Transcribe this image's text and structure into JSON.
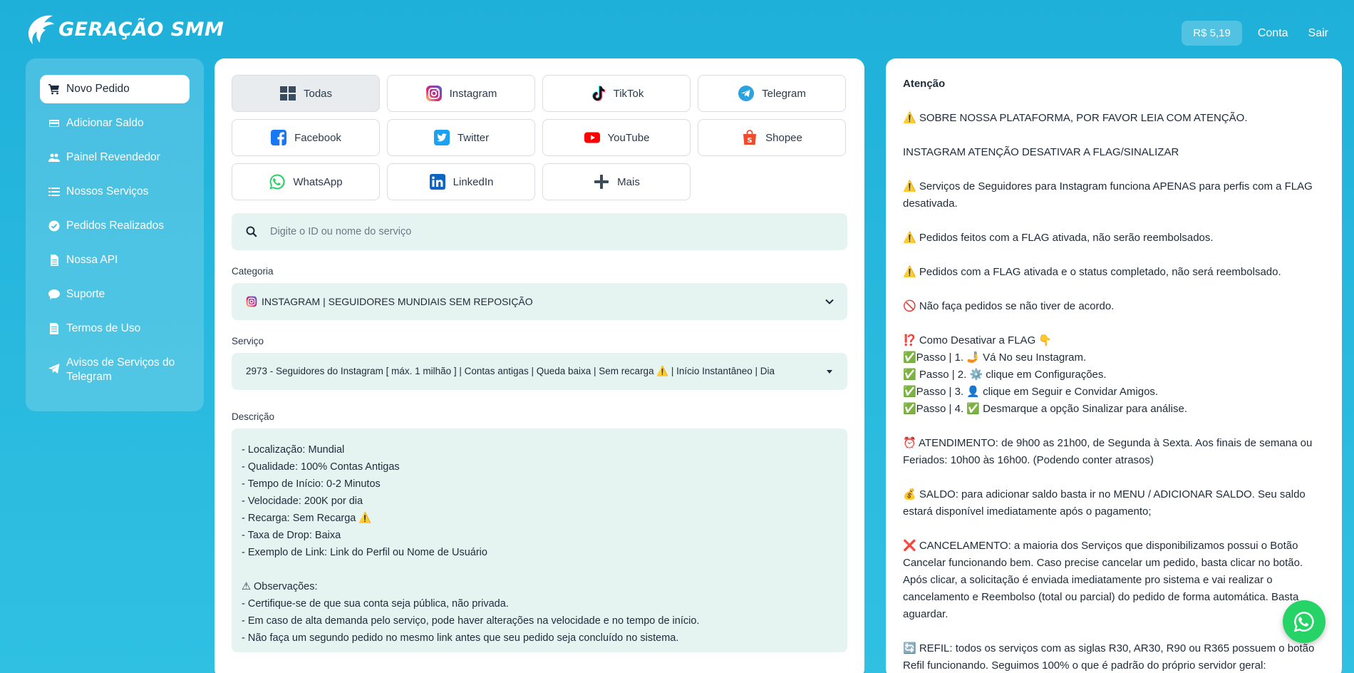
{
  "header": {
    "logo_text": "GERAÇÃO SMM",
    "balance": "R$ 5,19",
    "account_label": "Conta",
    "logout_label": "Sair"
  },
  "sidebar": {
    "items": [
      {
        "label": "Novo Pedido",
        "icon": "cart-icon"
      },
      {
        "label": "Adicionar Saldo",
        "icon": "credit-card-icon"
      },
      {
        "label": "Painel Revendedor",
        "icon": "users-icon"
      },
      {
        "label": "Nossos Serviços",
        "icon": "list-icon"
      },
      {
        "label": "Pedidos Realizados",
        "icon": "check-circle-icon"
      },
      {
        "label": "Nossa API",
        "icon": "file-icon"
      },
      {
        "label": "Suporte",
        "icon": "chat-icon"
      },
      {
        "label": "Termos de Uso",
        "icon": "document-icon"
      },
      {
        "label": "Avisos de Serviços do Telegram",
        "icon": "telegram-icon"
      }
    ]
  },
  "platform_tabs": [
    {
      "label": "Todas",
      "icon": "grid-icon"
    },
    {
      "label": "Instagram",
      "icon": "instagram-icon"
    },
    {
      "label": "TikTok",
      "icon": "tiktok-icon"
    },
    {
      "label": "Telegram",
      "icon": "telegram-icon"
    },
    {
      "label": "Facebook",
      "icon": "facebook-icon"
    },
    {
      "label": "Twitter",
      "icon": "twitter-icon"
    },
    {
      "label": "YouTube",
      "icon": "youtube-icon"
    },
    {
      "label": "Shopee",
      "icon": "shopee-icon"
    },
    {
      "label": "WhatsApp",
      "icon": "whatsapp-icon"
    },
    {
      "label": "LinkedIn",
      "icon": "linkedin-icon"
    },
    {
      "label": "Mais",
      "icon": "plus-icon"
    }
  ],
  "search": {
    "placeholder": "Digite o ID ou nome do serviço"
  },
  "category": {
    "label": "Categoria",
    "value": "INSTAGRAM | SEGUIDORES MUNDIAIS SEM REPOSIÇÃO"
  },
  "service": {
    "label": "Serviço",
    "value": "2973 - Seguidores do Instagram [ máx. 1 milhão ] | Contas antigas | Queda baixa | Sem recarga ⚠️ | Início Instantâneo | Dia"
  },
  "description": {
    "label": "Descrição",
    "lines": [
      "- Localização: Mundial",
      "- Qualidade: 100% Contas Antigas",
      "- Tempo de Início: 0-2 Minutos",
      "- Velocidade: 200K por dia",
      "- Recarga: Sem Recarga ⚠️",
      "- Taxa de Drop: Baixa",
      "- Exemplo de Link: Link do Perfil ou Nome de Usuário",
      "",
      "⚠ Observações:",
      "- Certifique-se de que sua conta seja pública, não privada.",
      "- Em caso de alta demanda pelo serviço, pode haver alterações na velocidade e no tempo de início.",
      "- Não faça um segundo pedido no mesmo link antes que seu pedido seja concluído no sistema."
    ]
  },
  "notice": {
    "title": "Atenção",
    "p1": "⚠️ SOBRE NOSSA PLATAFORMA, POR FAVOR LEIA COM ATENÇÃO.",
    "p2": "INSTAGRAM ATENÇÃO DESATIVAR A FLAG/SINALIZAR",
    "p3": "⚠️ Serviços de Seguidores para Instagram funciona APENAS para perfis com a FLAG desativada.",
    "p4": "⚠️ Pedidos feitos com a FLAG ativada, não serão reembolsados.",
    "p5": "⚠️ Pedidos com a FLAG ativada e o status completado, não será reembolsado.",
    "p6": "🚫 Não faça pedidos se não tiver de acordo.",
    "steps": [
      "⁉️ Como Desativar a FLAG 👇",
      "✅Passo | 1. 🤳 Vá No seu Instagram.",
      "✅ Passo | 2. ⚙️ clique em Configurações.",
      "✅Passo | 3. 👤 clique em Seguir e Convidar Amigos.",
      "✅Passo | 4. ✅ Desmarque a opção Sinalizar para análise."
    ],
    "p7": "⏰ ATENDIMENTO: de 9h00 as 21h00, de Segunda à Sexta. Aos finais de semana ou Feriados: 10h00 às 16h00. (Podendo conter atrasos)",
    "p8": "💰 SALDO: para adicionar saldo basta ir no MENU / ADICIONAR SALDO. Seu saldo estará disponível imediatamente após o pagamento;",
    "p9": "❌ CANCELAMENTO: a maioria dos Serviços que disponibilizamos possui o Botão Cancelar funcionando bem. Caso precise cancelar um pedido, basta clicar no botão. Após clicar, a solicitação é enviada imediatamente pro sistema e vai realizar o cancelamento e Reembolso (total ou parcial) do pedido de forma automática. Basta aguardar.",
    "p10": "🔄 REFIL: todos os serviços com as siglas R30, AR30, R90 ou R365 possuem o botão Refil funcionando. Seguimos 100% o que é padrão do próprio servidor geral:"
  },
  "colors": {
    "background": "#22b4dc",
    "panel": "#ffffff",
    "input_bg": "#e6f4f1",
    "whatsapp": "#25d366"
  }
}
